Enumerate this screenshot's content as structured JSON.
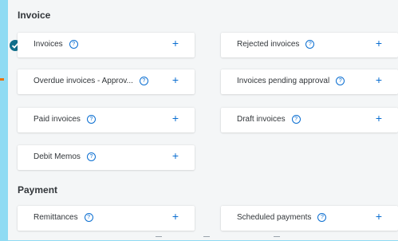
{
  "sections": {
    "invoice_title": "Invoice",
    "payment_title": "Payment"
  },
  "tiles": [
    {
      "label": "Invoices"
    },
    {
      "label": "Rejected invoices"
    },
    {
      "label": "Overdue invoices - Approv..."
    },
    {
      "label": "Invoices pending approval"
    },
    {
      "label": "Paid invoices"
    },
    {
      "label": "Draft invoices"
    },
    {
      "label": "Debit Memos"
    },
    {
      "label": "Remittances"
    },
    {
      "label": "Scheduled payments"
    }
  ],
  "icons": {
    "help": "?",
    "add": "+"
  },
  "colors": {
    "accent": "#0a6ed1",
    "selected": "#0f6e8b",
    "background": "#f4f6f7",
    "frame": "#8fdbf3"
  }
}
